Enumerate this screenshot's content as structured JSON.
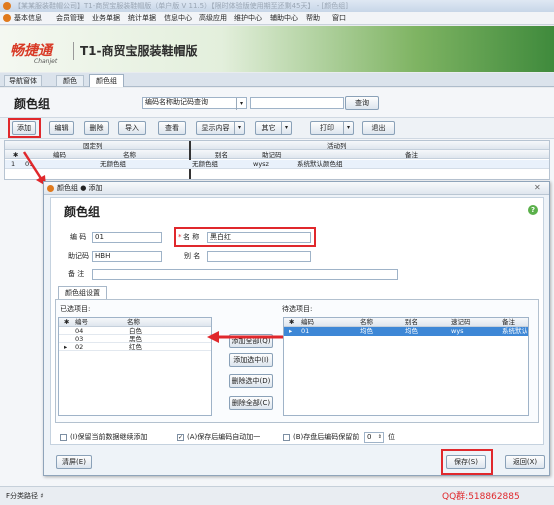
{
  "app": {
    "title": "【某某服装鞋帽公司】T1-商贸宝服装鞋帽版（单户版 V 11.5）【限时体验版使用期至还剩45天】 - [颜色组]",
    "menu": [
      "基本信息",
      "会员管理",
      "业务单据",
      "统计单据",
      "信息中心",
      "高级应用",
      "维护中心",
      "辅助中心",
      "帮助",
      "窗口"
    ]
  },
  "banner": {
    "brand_cn": "畅捷通",
    "brand_en": "Chanjet",
    "product": "T1-商贸宝服装鞋帽版"
  },
  "tabs": [
    "导航窗体",
    "颜色",
    "颜色组"
  ],
  "page": {
    "title": "颜色组",
    "search_mode": "编码名称助记码查询",
    "search_value": "",
    "search_button": "查询"
  },
  "toolbar": [
    "添加",
    "编辑",
    "删除",
    "导入",
    "查看",
    "显示内容",
    "其它",
    "打印",
    "退出"
  ],
  "grid": {
    "group_fixed": "固定列",
    "group_active": "活动列",
    "headers": [
      "编码",
      "名称",
      "别名",
      "助记码",
      "备注"
    ],
    "rows": [
      {
        "idx": "1",
        "code": "01",
        "name": "无颜色组",
        "alias": "无颜色组",
        "mnemonic": "wysz",
        "note": "系统默认颜色组"
      }
    ]
  },
  "dialog": {
    "titlebar": "颜色组 ● 添加",
    "heading": "颜色组",
    "labels": {
      "code": "编 码",
      "name": "名 称",
      "mnemonic": "助记码",
      "alias": "别 名",
      "note": "备 注"
    },
    "values": {
      "code": "01",
      "name": "黑白红",
      "mnemonic": "HBH",
      "alias": "",
      "note": ""
    },
    "settings_tab": "颜色组设置",
    "selected_label": "已选项目:",
    "pending_label": "待选项目:",
    "selected_headers": [
      "编号",
      "名称"
    ],
    "selected_rows": [
      {
        "code": "04",
        "name": "白色"
      },
      {
        "code": "03",
        "name": "黑色"
      },
      {
        "code": "02",
        "name": "红色"
      }
    ],
    "pending_headers": [
      "编码",
      "名称",
      "别名",
      "速记码",
      "备注"
    ],
    "pending_rows": [
      {
        "code": "01",
        "name": "均色",
        "alias": "均色",
        "mnemonic": "wys",
        "note": "系统默认"
      }
    ],
    "move_buttons": [
      "添加全部(Q)",
      "添加选中(I)",
      "删除选中(D)",
      "删除全部(C)"
    ],
    "options": {
      "keep_data": "(I)保留当前数据继续添加",
      "auto_increment": "(A)保存后编码自动加一",
      "keep_digits_prefix": "(B)存盘后编码保留前",
      "keep_digits_value": "0",
      "keep_digits_suffix": "位"
    },
    "clear_button": "清屏(E)",
    "save_button": "保存(S)",
    "back_button": "返回(X)"
  },
  "status": {
    "path": "F分类路径 ♯",
    "qq": "QQ群:518862885"
  },
  "colors": {
    "accent_red": "#e0282c",
    "banner_green": "#3f8a3c",
    "selected_row": "#3d87d6"
  }
}
